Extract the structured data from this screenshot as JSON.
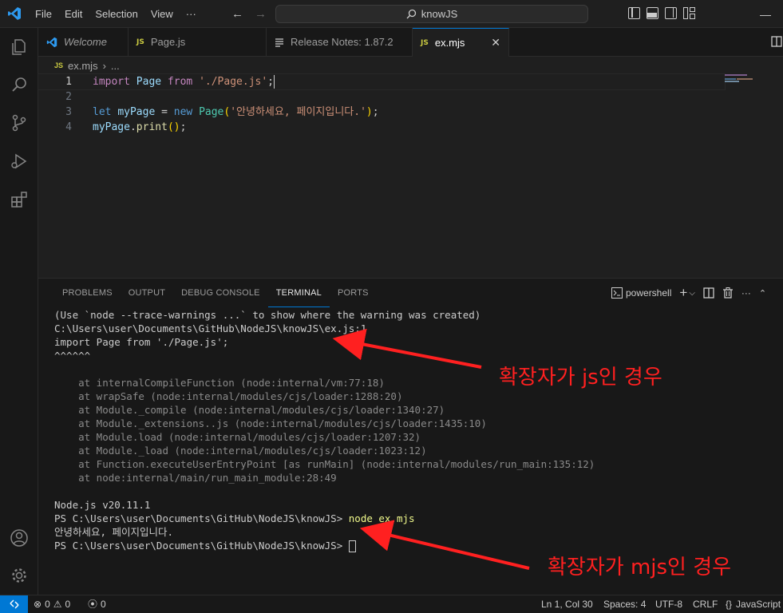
{
  "titlebar": {
    "menu": [
      "File",
      "Edit",
      "Selection",
      "View",
      "···"
    ],
    "search": "knowJS"
  },
  "tabs": [
    {
      "label": "Welcome",
      "icon": "vscode-icon"
    },
    {
      "label": "Page.js",
      "icon": "JS"
    },
    {
      "label": "Release Notes: 1.87.2",
      "icon": "doc-icon"
    },
    {
      "label": "ex.mjs",
      "icon": "JS",
      "close": "✕"
    }
  ],
  "breadcrumb": {
    "file_icon": "JS",
    "file": "ex.mjs",
    "sep": "›",
    "more": "..."
  },
  "editor": {
    "lines": [
      {
        "n": "1"
      },
      {
        "n": "2"
      },
      {
        "n": "3"
      },
      {
        "n": "4"
      }
    ],
    "tokens": {
      "import": "import",
      "Page": "Page",
      "from": "from",
      "path": "'./Page.js'",
      "semi": ";",
      "let": "let",
      "myPage": "myPage",
      "eq": "=",
      "new": "new",
      "Page2": "Page",
      "popen": "(",
      "msg": "'안녕하세요, 페이지입니다.'",
      "pclose": ")",
      "semi2": ";",
      "myPage2": "myPage",
      "dot": ".",
      "print": "print",
      "call": "()",
      "semi3": ";"
    }
  },
  "panel": {
    "tabs": [
      "PROBLEMS",
      "OUTPUT",
      "DEBUG CONSOLE",
      "TERMINAL",
      "PORTS"
    ],
    "shell": "powershell",
    "terminal": {
      "l1": "(Use `node --trace-warnings ...` to show where the warning was created)",
      "l2": "C:\\Users\\user\\Documents\\GitHub\\NodeJS\\knowJS\\ex.js:1",
      "l3": "import Page from './Page.js';",
      "l4": "^^^^^^",
      "l5": "",
      "l6": "    at internalCompileFunction (node:internal/vm:77:18)",
      "l7": "    at wrapSafe (node:internal/modules/cjs/loader:1288:20)",
      "l8": "    at Module._compile (node:internal/modules/cjs/loader:1340:27)",
      "l9": "    at Module._extensions..js (node:internal/modules/cjs/loader:1435:10)",
      "l10": "    at Module.load (node:internal/modules/cjs/loader:1207:32)",
      "l11": "    at Module._load (node:internal/modules/cjs/loader:1023:12)",
      "l12": "    at Function.executeUserEntryPoint [as runMain] (node:internal/modules/run_main:135:12)",
      "l13": "    at node:internal/main/run_main_module:28:49",
      "l14": "",
      "l15": "Node.js v20.11.1",
      "prompt": "PS C:\\Users\\user\\Documents\\GitHub\\NodeJS\\knowJS> ",
      "cmd": "node ex.mjs",
      "output": "안녕하세요, 페이지입니다.",
      "prompt2": "PS C:\\Users\\user\\Documents\\GitHub\\NodeJS\\knowJS> "
    }
  },
  "annotations": {
    "a1": "확장자가 js인 경우",
    "a2": "확장자가 mjs인 경우"
  },
  "statusbar": {
    "errors": "0",
    "warnings": "0",
    "ports": "0",
    "position": "Ln 1, Col 30",
    "spaces": "Spaces: 4",
    "encoding": "UTF-8",
    "eol": "CRLF",
    "lang_brace": "{}",
    "language": "JavaScript"
  },
  "colors": {
    "accent": "#0078d4",
    "annotation": "#ff2020"
  }
}
